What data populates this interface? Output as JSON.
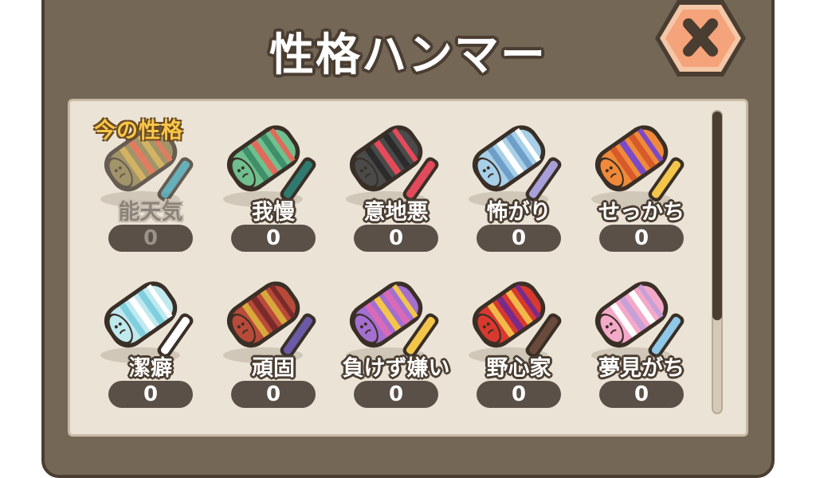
{
  "title": "性格ハンマー",
  "current_label": "今の性格",
  "close_icon": "close-x-icon",
  "colors": {
    "panel": "#756756",
    "panel_border": "#4a3d31",
    "content_bg": "#ebe3d6",
    "count_pill": "#5a5048",
    "current_label": "#f7c64a"
  },
  "hammers": [
    {
      "name": "能天気",
      "count": "0",
      "icon": "hammer-icon",
      "current": true,
      "head": "#8a7a45",
      "stripe": "#c9a43d",
      "accent": "#e05a3a",
      "handle": "#3a9fb0"
    },
    {
      "name": "我慢",
      "count": "0",
      "icon": "hammer-icon",
      "current": false,
      "head": "#6fbf8f",
      "stripe": "#3f8f6a",
      "accent": "#e26a5a",
      "handle": "#2f7a70"
    },
    {
      "name": "意地悪",
      "count": "0",
      "icon": "hammer-icon",
      "current": false,
      "head": "#4a4a4a",
      "stripe": "#2b2b2b",
      "accent": "#e64a5a",
      "handle": "#e04a5a"
    },
    {
      "name": "怖がり",
      "count": "0",
      "icon": "hammer-icon",
      "current": false,
      "head": "#a7cfe8",
      "stripe": "#6f9fc8",
      "accent": "#ffffff",
      "handle": "#a7a0d8"
    },
    {
      "name": "せっかち",
      "count": "0",
      "icon": "hammer-icon",
      "current": false,
      "head": "#f08a3a",
      "stripe": "#d65a2a",
      "accent": "#7a4ac8",
      "handle": "#f3c64a"
    },
    {
      "name": "潔癖",
      "count": "0",
      "icon": "hammer-icon",
      "current": false,
      "head": "#bfe9ef",
      "stripe": "#7fcfdf",
      "accent": "#ffffff",
      "handle": "#ffffff"
    },
    {
      "name": "頑固",
      "count": "0",
      "icon": "hammer-icon",
      "current": false,
      "head": "#b84a3a",
      "stripe": "#d8a83a",
      "accent": "#7a2a2a",
      "handle": "#6a5aa8"
    },
    {
      "name": "負けず嫌い",
      "count": "0",
      "icon": "hammer-icon",
      "current": false,
      "head": "#a36fd0",
      "stripe": "#d86ab8",
      "accent": "#f3c64a",
      "handle": "#f3c64a"
    },
    {
      "name": "野心家",
      "count": "0",
      "icon": "hammer-icon",
      "current": false,
      "head": "#d8392f",
      "stripe": "#f3b84a",
      "accent": "#7a2a8a",
      "handle": "#6a4a3a"
    },
    {
      "name": "夢見がち",
      "count": "0",
      "icon": "hammer-icon",
      "current": false,
      "head": "#f5a9c8",
      "stripe": "#ffffff",
      "accent": "#c8a0d8",
      "handle": "#8fc8e8"
    }
  ]
}
